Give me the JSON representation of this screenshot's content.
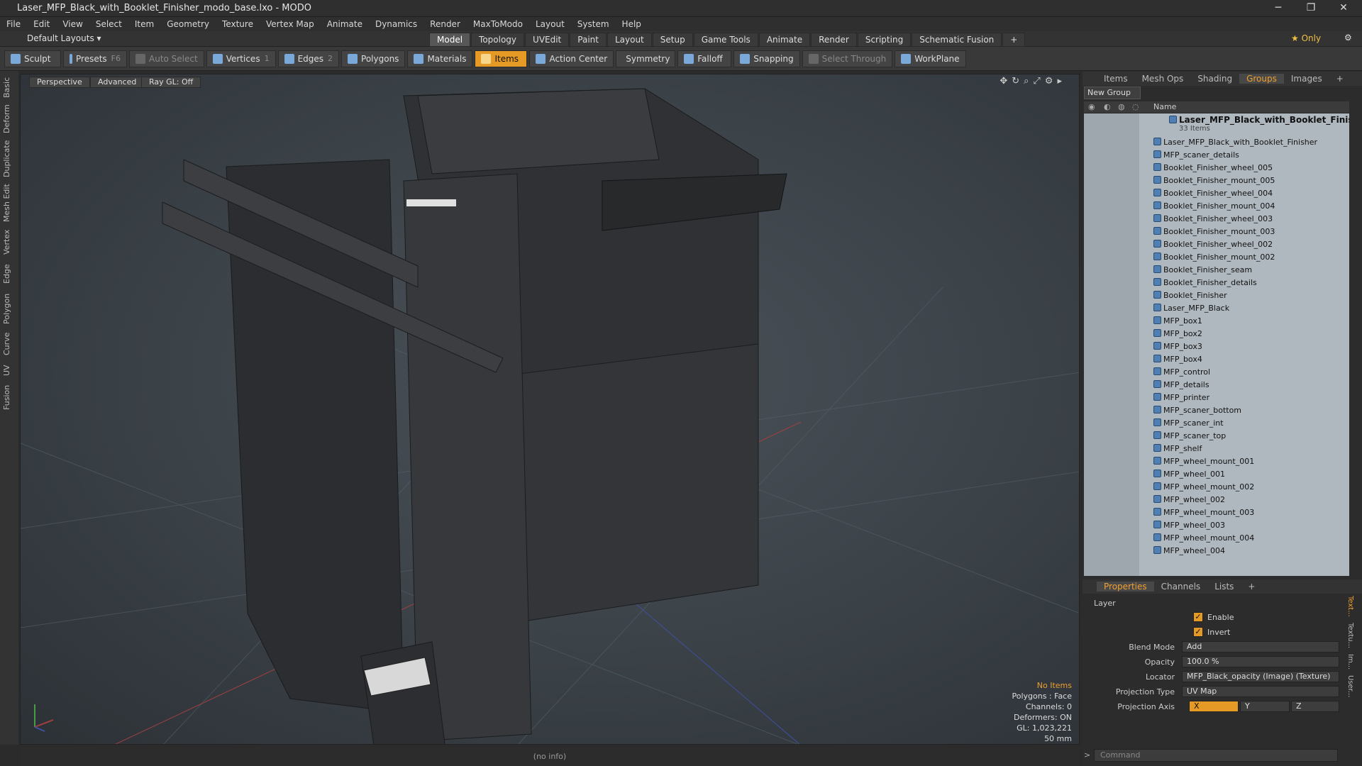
{
  "window": {
    "title": "Laser_MFP_Black_with_Booklet_Finisher_modo_base.lxo - MODO",
    "min": "─",
    "max": "❐",
    "close": "✕"
  },
  "menu": [
    "File",
    "Edit",
    "View",
    "Select",
    "Item",
    "Geometry",
    "Texture",
    "Vertex Map",
    "Animate",
    "Dynamics",
    "Render",
    "MaxToModo",
    "Layout",
    "System",
    "Help"
  ],
  "layout": {
    "selector": "Default Layouts ▾",
    "only": "★ Only"
  },
  "modes": [
    "Model",
    "Topology",
    "UVEdit",
    "Paint",
    "Layout",
    "Setup",
    "Game Tools",
    "Animate",
    "Render",
    "Scripting",
    "Schematic Fusion"
  ],
  "toolbar": {
    "sculpt": "Sculpt",
    "presets": "Presets",
    "presets_key": "F6",
    "auto_select": "Auto Select",
    "vertices": "Vertices",
    "vertices_n": "1",
    "edges": "Edges",
    "edges_n": "2",
    "polygons": "Polygons",
    "materials": "Materials",
    "items": "Items",
    "action_center": "Action Center",
    "symmetry": "Symmetry",
    "falloff": "Falloff",
    "snapping": "Snapping",
    "select_through": "Select Through",
    "workplane": "WorkPlane"
  },
  "lefttabs": [
    "Basic",
    "Deform",
    "Duplicate",
    "Mesh Edit",
    "Vertex",
    "Edge",
    "Polygon",
    "Curve",
    "UV",
    "Fusion"
  ],
  "viewport": {
    "perspective": "Perspective",
    "advanced": "Advanced",
    "raygl": "Ray GL: Off",
    "info": {
      "no_items": "No Items",
      "polygons": "Polygons : Face",
      "channels": "Channels: 0",
      "deformers": "Deformers: ON",
      "gl": "GL: 1,023,221",
      "focal": "50 mm"
    }
  },
  "status": "(no info)",
  "panel_tabs": [
    "Items",
    "Mesh Ops",
    "Shading",
    "Groups",
    "Images"
  ],
  "new_group": "New Group",
  "tree": {
    "header": "Name",
    "root": "Laser_MFP_Black_with_Booklet_Finisher",
    "count": "33 Items",
    "items": [
      "Laser_MFP_Black_with_Booklet_Finisher",
      "MFP_scaner_details",
      "Booklet_Finisher_wheel_005",
      "Booklet_Finisher_mount_005",
      "Booklet_Finisher_wheel_004",
      "Booklet_Finisher_mount_004",
      "Booklet_Finisher_wheel_003",
      "Booklet_Finisher_mount_003",
      "Booklet_Finisher_wheel_002",
      "Booklet_Finisher_mount_002",
      "Booklet_Finisher_seam",
      "Booklet_Finisher_details",
      "Booklet_Finisher",
      "Laser_MFP_Black",
      "MFP_box1",
      "MFP_box2",
      "MFP_box3",
      "MFP_box4",
      "MFP_control",
      "MFP_details",
      "MFP_printer",
      "MFP_scaner_bottom",
      "MFP_scaner_int",
      "MFP_scaner_top",
      "MFP_shelf",
      "MFP_wheel_mount_001",
      "MFP_wheel_001",
      "MFP_wheel_mount_002",
      "MFP_wheel_002",
      "MFP_wheel_mount_003",
      "MFP_wheel_003",
      "MFP_wheel_mount_004",
      "MFP_wheel_004"
    ]
  },
  "prop_tabs": [
    "Properties",
    "Channels",
    "Lists"
  ],
  "props": {
    "section": "Layer",
    "enable": "Enable",
    "invert": "Invert",
    "blend_label": "Blend Mode",
    "blend": "Add",
    "opacity_label": "Opacity",
    "opacity": "100.0 %",
    "locator_label": "Locator",
    "locator": "MFP_Black_opacity (Image) (Texture)",
    "proj_type_label": "Projection Type",
    "proj_type": "UV Map",
    "proj_axis_label": "Projection Axis",
    "axis_x": "X",
    "axis_y": "Y",
    "axis_z": "Z"
  },
  "right_vtabs": [
    "Text...",
    "Textu...",
    "Im...",
    "User..."
  ],
  "command": "Command"
}
